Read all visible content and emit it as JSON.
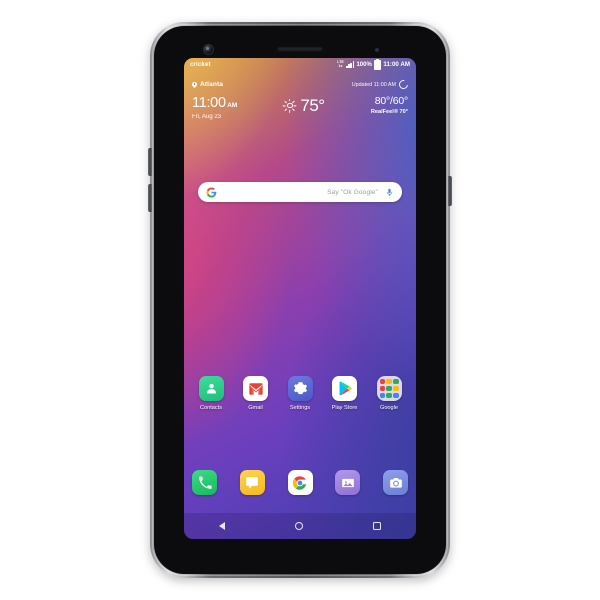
{
  "device": {
    "type": "smartphone",
    "frame_color": "#8e9094",
    "hardware": {
      "front_camera": "front-camera",
      "earpiece": "earpiece-speaker",
      "proximity_sensor": "proximity-sensor",
      "volume_up": "volume-up-button",
      "volume_down": "volume-down-button",
      "power": "power-button"
    }
  },
  "statusbar": {
    "carrier": "cricket",
    "network_line1": "LTE",
    "network_line2": "1x",
    "battery_percent": "100%",
    "time": "11:00 AM",
    "signal_icon": "signal-bars-icon",
    "battery_icon": "battery-full-icon"
  },
  "widget": {
    "location": "Atlanta",
    "location_icon": "location-pin-icon",
    "updated": "Updated 11:00 AM",
    "refresh_icon": "refresh-icon",
    "time": "11:00",
    "meridiem": "AM",
    "date": "Fri, Aug 23",
    "condition_icon": "sunny-icon",
    "temperature": "75°",
    "high_low": "80°/60°",
    "realfeel": "RealFeel® 70°"
  },
  "search": {
    "logo_icon": "google-g-icon",
    "placeholder": "Say \"Ok Google\"",
    "mic_icon": "microphone-icon"
  },
  "apps": [
    {
      "label": "Contacts",
      "icon": "contacts-icon"
    },
    {
      "label": "Gmail",
      "icon": "gmail-icon"
    },
    {
      "label": "Settings",
      "icon": "settings-gear-icon"
    },
    {
      "label": "Play Store",
      "icon": "play-store-icon"
    },
    {
      "label": "Google",
      "icon": "google-folder-icon"
    }
  ],
  "folder_colors": [
    "#ea4335",
    "#fbbc04",
    "#34a853",
    "#ea4335",
    "#34a853",
    "#fbbc04",
    "#4285f4",
    "#34a853",
    "#4285f4"
  ],
  "dock": [
    {
      "name": "Phone",
      "icon": "phone-icon"
    },
    {
      "name": "Messages",
      "icon": "messages-icon"
    },
    {
      "name": "Chrome",
      "icon": "chrome-icon"
    },
    {
      "name": "Photos",
      "icon": "photos-icon"
    },
    {
      "name": "Camera",
      "icon": "camera-icon"
    }
  ],
  "navbar": [
    {
      "name": "Back",
      "icon": "back-triangle-icon"
    },
    {
      "name": "Home",
      "icon": "home-circle-icon"
    },
    {
      "name": "Recents",
      "icon": "recents-square-icon"
    }
  ],
  "wallpaper": {
    "colors": [
      "#f0b542",
      "#d4417f",
      "#8c3fae",
      "#3f63c8",
      "#3f3fae"
    ]
  }
}
